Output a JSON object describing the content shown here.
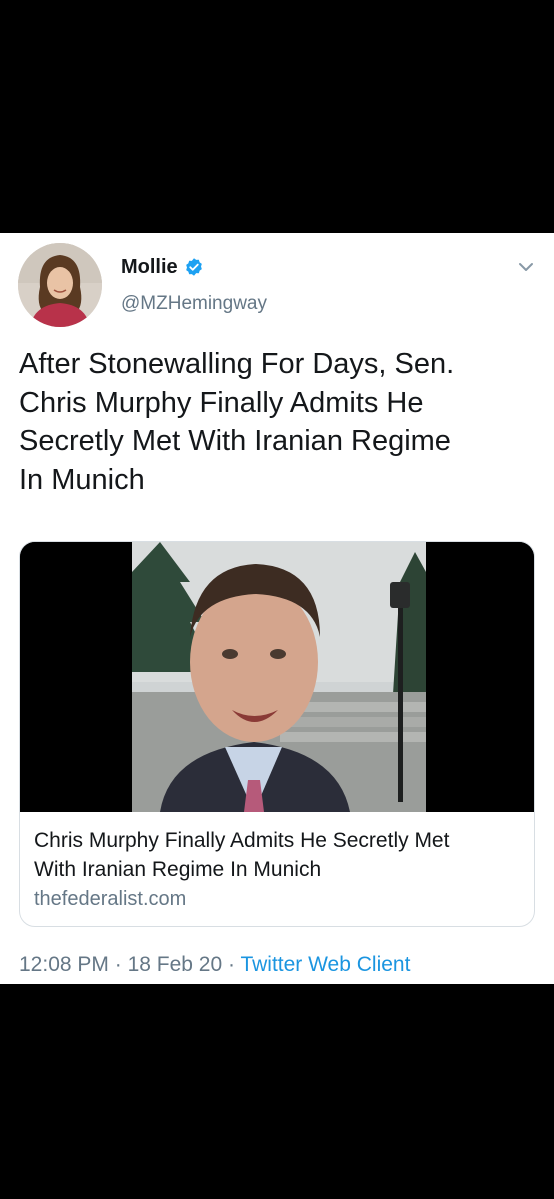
{
  "tweet": {
    "display_name": "Mollie",
    "handle": "@MZHemingway",
    "verified": true,
    "text_lines": [
      "After Stonewalling For Days, Sen.",
      "Chris Murphy Finally Admits He",
      "Secretly Met With Iranian Regime",
      "In Munich"
    ],
    "card": {
      "title_lines": [
        "Chris Murphy Finally Admits He Secretly Met",
        "With Iranian Regime In Munich"
      ],
      "domain": "thefederalist.com"
    },
    "time": "12:08 PM",
    "separator": " · ",
    "date": "18 Feb 20",
    "client": "Twitter Web Client"
  },
  "colors": {
    "verified_blue": "#1da1f2",
    "link_blue": "#1b95e0",
    "secondary_text": "#657786",
    "primary_text": "#14171a"
  },
  "icons": {
    "verified": "verified-badge-icon",
    "caret": "chevron-down-icon"
  }
}
